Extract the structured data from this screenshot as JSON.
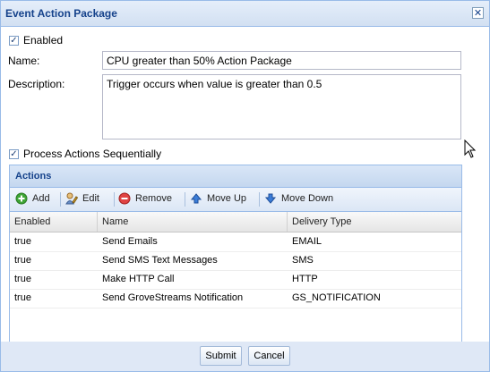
{
  "window": {
    "title": "Event Action Package",
    "close_glyph": "✕"
  },
  "form": {
    "enabled_label": "Enabled",
    "enabled_checked": true,
    "name_label": "Name:",
    "name_value": "CPU greater than 50% Action Package",
    "description_label": "Description:",
    "description_value": "Trigger occurs when value is greater than 0.5",
    "sequential_label": "Process Actions Sequentially",
    "sequential_checked": true
  },
  "actions_panel": {
    "title": "Actions",
    "toolbar": {
      "add": "Add",
      "edit": "Edit",
      "remove": "Remove",
      "move_up": "Move Up",
      "move_down": "Move Down"
    },
    "columns": [
      "Enabled",
      "Name",
      "Delivery Type"
    ],
    "rows": [
      [
        "true",
        "Send Emails",
        "EMAIL"
      ],
      [
        "true",
        "Send SMS Text Messages",
        "SMS"
      ],
      [
        "true",
        "Make HTTP Call",
        "HTTP"
      ],
      [
        "true",
        "Send GroveStreams Notification",
        "GS_NOTIFICATION"
      ]
    ]
  },
  "footer": {
    "submit": "Submit",
    "cancel": "Cancel"
  },
  "colors": {
    "accent": "#15428b",
    "border": "#99bbe8",
    "frame": "#dfe8f6"
  }
}
